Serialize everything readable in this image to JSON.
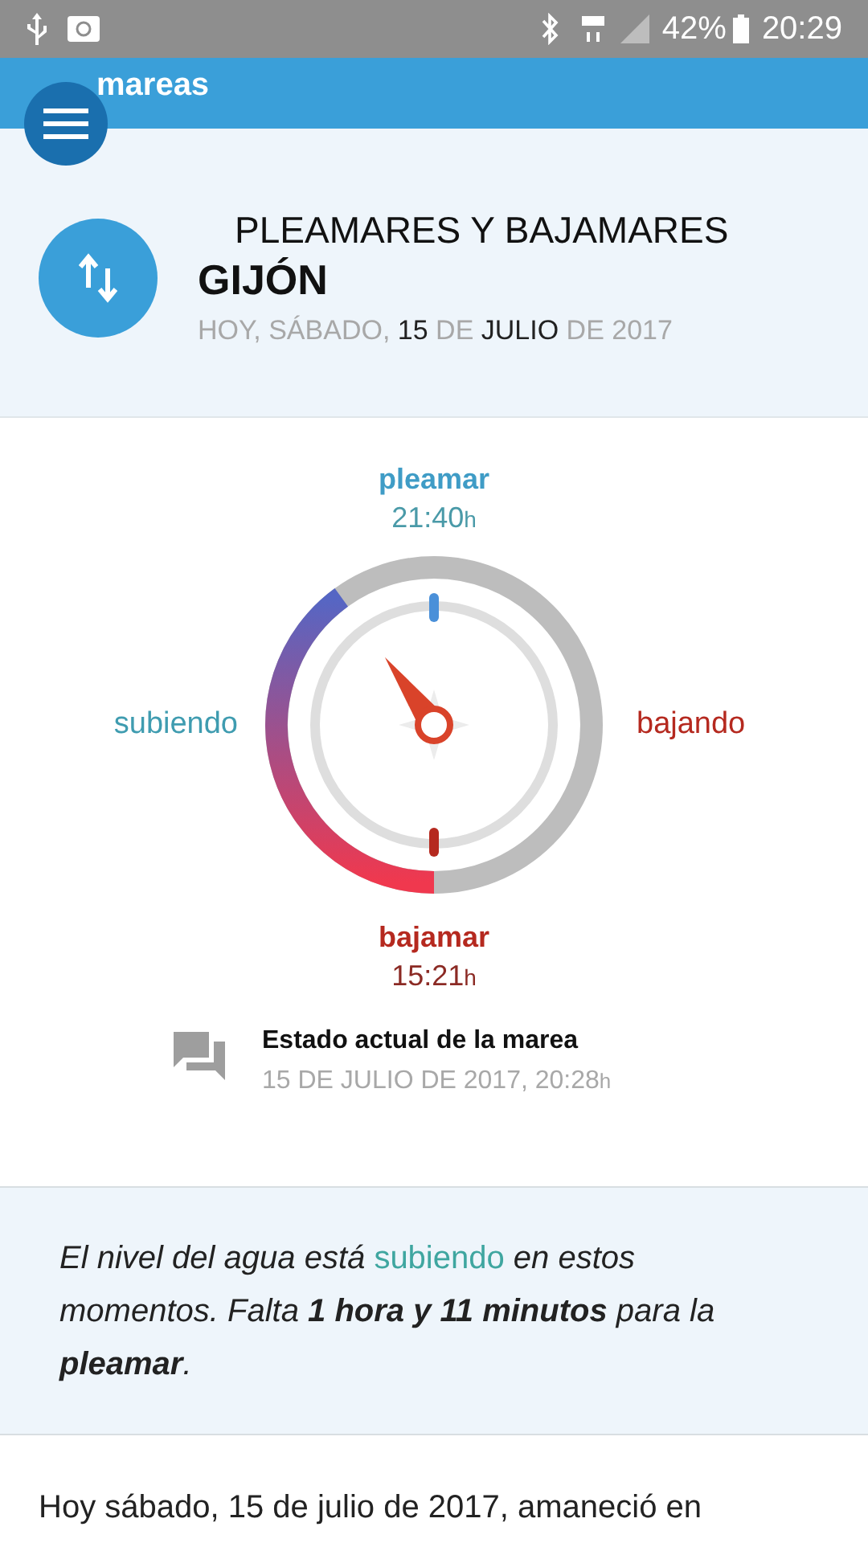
{
  "status_bar": {
    "battery": "42%",
    "time": "20:29"
  },
  "app_bar": {
    "logo": "mareas"
  },
  "header": {
    "title": "PLEAMARES Y BAJAMARES",
    "place": "GIJÓN",
    "date": [
      {
        "text": "HOY, SÁBADO,",
        "emphasis": false
      },
      {
        "text": "15",
        "emphasis": true
      },
      {
        "text": "DE",
        "emphasis": false
      },
      {
        "text": "JULIO",
        "emphasis": true
      },
      {
        "text": "DE 2017",
        "emphasis": false
      }
    ]
  },
  "dial": {
    "high": {
      "label": "pleamar",
      "time": "21:40",
      "unit": "h"
    },
    "low": {
      "label": "bajamar",
      "time": "15:21",
      "unit": "h"
    },
    "rising_label": "subiendo",
    "falling_label": "bajando"
  },
  "current": {
    "title": "Estado actual de la marea",
    "time": "15 DE JULIO DE 2017, 20:28",
    "unit": "h"
  },
  "summary": [
    {
      "text": "El nivel del agua está ",
      "kind": "plain"
    },
    {
      "text": "subiendo",
      "kind": "accent"
    },
    {
      "text": " en estos momentos. Falta ",
      "kind": "plain"
    },
    {
      "text": "1 hora y 11 minutos",
      "kind": "bold"
    },
    {
      "text": " para la ",
      "kind": "plain"
    },
    {
      "text": "pleamar",
      "kind": "bold"
    },
    {
      "text": ".",
      "kind": "plain"
    }
  ],
  "body": "Hoy sábado, 15 de julio de 2017, amaneció en"
}
